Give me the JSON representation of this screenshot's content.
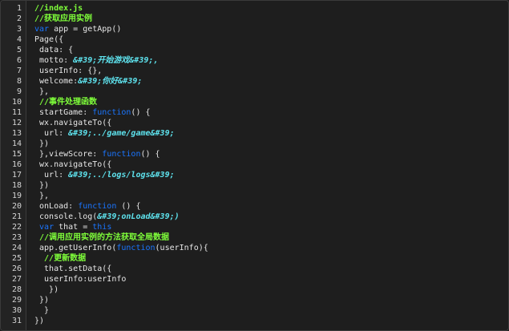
{
  "editor": {
    "lines": [
      {
        "number": "1",
        "tokens": [
          {
            "t": "comment",
            "v": "//index.js"
          }
        ]
      },
      {
        "number": "2",
        "tokens": [
          {
            "t": "comment",
            "v": "//获取应用实例"
          }
        ]
      },
      {
        "number": "3",
        "tokens": [
          {
            "t": "keyword",
            "v": "var"
          },
          {
            "t": "plain",
            "v": " app = getApp()"
          }
        ]
      },
      {
        "number": "4",
        "tokens": [
          {
            "t": "plain",
            "v": "Page({"
          }
        ]
      },
      {
        "number": "5",
        "tokens": [
          {
            "t": "plain",
            "v": " data: {"
          }
        ]
      },
      {
        "number": "6",
        "tokens": [
          {
            "t": "plain",
            "v": " motto: "
          },
          {
            "t": "string",
            "v": "&#39;开始游戏&#39;,"
          }
        ]
      },
      {
        "number": "7",
        "tokens": [
          {
            "t": "plain",
            "v": " userInfo: {},"
          }
        ]
      },
      {
        "number": "8",
        "tokens": [
          {
            "t": "plain",
            "v": " welcome:"
          },
          {
            "t": "string",
            "v": "&#39;你好&#39;"
          }
        ]
      },
      {
        "number": "9",
        "tokens": [
          {
            "t": "plain",
            "v": " },"
          }
        ]
      },
      {
        "number": "10",
        "tokens": [
          {
            "t": "comment",
            "v": " //事件处理函数"
          }
        ]
      },
      {
        "number": "11",
        "tokens": [
          {
            "t": "plain",
            "v": " startGame: "
          },
          {
            "t": "keyword",
            "v": "function"
          },
          {
            "t": "plain",
            "v": "() {"
          }
        ]
      },
      {
        "number": "12",
        "tokens": [
          {
            "t": "plain",
            "v": " wx.navigateTo({"
          }
        ]
      },
      {
        "number": "13",
        "tokens": [
          {
            "t": "plain",
            "v": "  url: "
          },
          {
            "t": "string",
            "v": "&#39;../game/game&#39;"
          }
        ]
      },
      {
        "number": "14",
        "tokens": [
          {
            "t": "plain",
            "v": " })"
          }
        ]
      },
      {
        "number": "15",
        "tokens": [
          {
            "t": "plain",
            "v": " },viewScore: "
          },
          {
            "t": "keyword",
            "v": "function"
          },
          {
            "t": "plain",
            "v": "() {"
          }
        ]
      },
      {
        "number": "16",
        "tokens": [
          {
            "t": "plain",
            "v": " wx.navigateTo({"
          }
        ]
      },
      {
        "number": "17",
        "tokens": [
          {
            "t": "plain",
            "v": "  url: "
          },
          {
            "t": "string",
            "v": "&#39;../logs/logs&#39;"
          }
        ]
      },
      {
        "number": "18",
        "tokens": [
          {
            "t": "plain",
            "v": " })"
          }
        ]
      },
      {
        "number": "19",
        "tokens": [
          {
            "t": "plain",
            "v": " },"
          }
        ]
      },
      {
        "number": "20",
        "tokens": [
          {
            "t": "plain",
            "v": " onLoad: "
          },
          {
            "t": "keyword",
            "v": "function"
          },
          {
            "t": "plain",
            "v": " () {"
          }
        ]
      },
      {
        "number": "21",
        "tokens": [
          {
            "t": "plain",
            "v": " console.log("
          },
          {
            "t": "string",
            "v": "&#39;onLoad&#39;)"
          }
        ]
      },
      {
        "number": "22",
        "tokens": [
          {
            "t": "plain",
            "v": " "
          },
          {
            "t": "keyword",
            "v": "var"
          },
          {
            "t": "plain",
            "v": " that = "
          },
          {
            "t": "keyword",
            "v": "this"
          }
        ]
      },
      {
        "number": "23",
        "tokens": [
          {
            "t": "comment",
            "v": " //调用应用实例的方法获取全局数据"
          }
        ]
      },
      {
        "number": "24",
        "tokens": [
          {
            "t": "plain",
            "v": " app.getUserInfo("
          },
          {
            "t": "keyword",
            "v": "function"
          },
          {
            "t": "plain",
            "v": "(userInfo){"
          }
        ]
      },
      {
        "number": "25",
        "tokens": [
          {
            "t": "comment",
            "v": "  //更新数据"
          }
        ]
      },
      {
        "number": "26",
        "tokens": [
          {
            "t": "plain",
            "v": "  that.setData({"
          }
        ]
      },
      {
        "number": "27",
        "tokens": [
          {
            "t": "plain",
            "v": "  userInfo:userInfo"
          }
        ]
      },
      {
        "number": "28",
        "tokens": [
          {
            "t": "plain",
            "v": "   })"
          }
        ]
      },
      {
        "number": "29",
        "tokens": [
          {
            "t": "plain",
            "v": " })"
          }
        ]
      },
      {
        "number": "30",
        "tokens": [
          {
            "t": "plain",
            "v": "  }"
          }
        ]
      },
      {
        "number": "31",
        "tokens": [
          {
            "t": "plain",
            "v": "})"
          }
        ]
      }
    ]
  },
  "colors": {
    "background": "#1e1e1e",
    "comment": "#7fff3a",
    "keyword": "#1a75ff",
    "string": "#5ee3ee",
    "plain": "#e6e6e6",
    "line_number": "#d4d4d4"
  }
}
